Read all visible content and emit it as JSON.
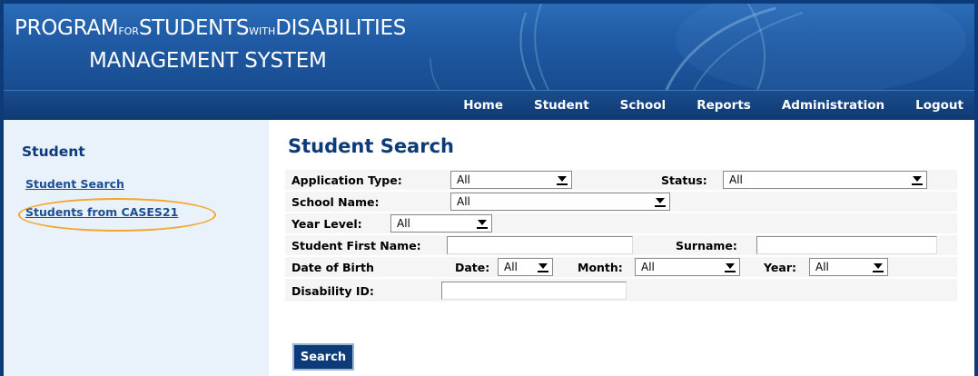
{
  "app": {
    "title_line1": {
      "program": "PROGRAM",
      "for": "FOR",
      "students": "STUDENTS",
      "with": "WITH",
      "disabilities": "DISABILITIES"
    },
    "title_line2": "MANAGEMENT SYSTEM"
  },
  "nav": {
    "items": [
      "Home",
      "Student",
      "School",
      "Reports",
      "Administration",
      "Logout"
    ]
  },
  "sidebar": {
    "heading": "Student",
    "links": [
      "Student Search",
      "Students from CASES21"
    ],
    "highlight_color": "#f3a629"
  },
  "main": {
    "title": "Student Search",
    "form": {
      "application_type": {
        "label": "Application Type:",
        "value": "All"
      },
      "status": {
        "label": "Status:",
        "value": "All"
      },
      "school_name": {
        "label": "School Name:",
        "value": "All"
      },
      "year_level": {
        "label": "Year Level:",
        "value": "All"
      },
      "first_name": {
        "label": "Student First Name:",
        "value": ""
      },
      "surname": {
        "label": "Surname:",
        "value": ""
      },
      "dob": {
        "label": "Date of Birth",
        "date_label": "Date:",
        "date_value": "All",
        "month_label": "Month:",
        "month_value": "All",
        "year_label": "Year:",
        "year_value": "All"
      },
      "disability_id": {
        "label": "Disability ID:",
        "value": ""
      }
    },
    "search_button": "Search"
  },
  "colors": {
    "navy": "#0d3a78",
    "banner_blue": "#1f5aa3",
    "sidebar_bg": "#e9f2fb",
    "link": "#1b4f93"
  }
}
